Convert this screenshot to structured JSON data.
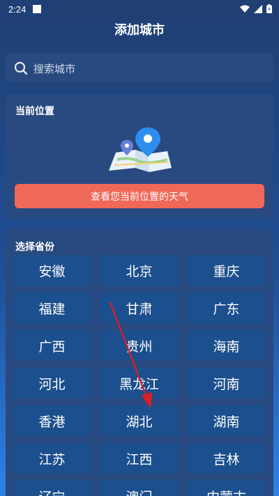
{
  "status_bar": {
    "time": "2:24"
  },
  "header": {
    "title": "添加城市"
  },
  "search": {
    "placeholder": "搜索城市"
  },
  "current_location": {
    "title": "当前位置",
    "button_label": "查看您当前位置的天气"
  },
  "provinces": {
    "title": "选择省份",
    "items": [
      "安徽",
      "北京",
      "重庆",
      "福建",
      "甘肃",
      "广东",
      "广西",
      "贵州",
      "海南",
      "河北",
      "黑龙江",
      "河南",
      "香港",
      "湖北",
      "湖南",
      "江苏",
      "江西",
      "吉林",
      "辽宁",
      "澳门",
      "内蒙古"
    ]
  },
  "colors": {
    "accent_button": "#f06858",
    "card_bg": "#284a80",
    "province_bg": "#1c4f8d",
    "annotation_arrow": "#e01e1e"
  }
}
